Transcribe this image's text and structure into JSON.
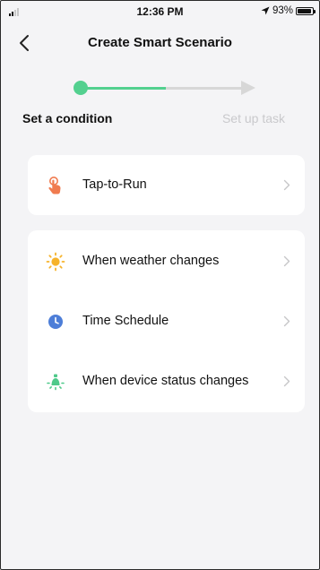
{
  "status_bar": {
    "time": "12:36 PM",
    "battery": "93%",
    "battery_level": 0.93
  },
  "header": {
    "title": "Create Smart Scenario",
    "back_icon": "chevron-left-icon"
  },
  "stepper": {
    "steps": [
      {
        "label": "Set a condition",
        "active": true
      },
      {
        "label": "Set up task",
        "active": false
      }
    ],
    "accent_color": "#53d08f",
    "inactive_color": "#d7d7d7"
  },
  "conditions": {
    "primary": [
      {
        "label": "Tap-to-Run",
        "icon": "hand-tap-icon",
        "color": "#f07b4f"
      }
    ],
    "secondary": [
      {
        "label": "When weather changes",
        "icon": "sun-icon",
        "color": "#f6b32b"
      },
      {
        "label": "Time Schedule",
        "icon": "clock-icon",
        "color": "#4d7ed8"
      },
      {
        "label": "When device status changes",
        "icon": "device-bulb-icon",
        "color": "#4fc98a"
      }
    ]
  }
}
